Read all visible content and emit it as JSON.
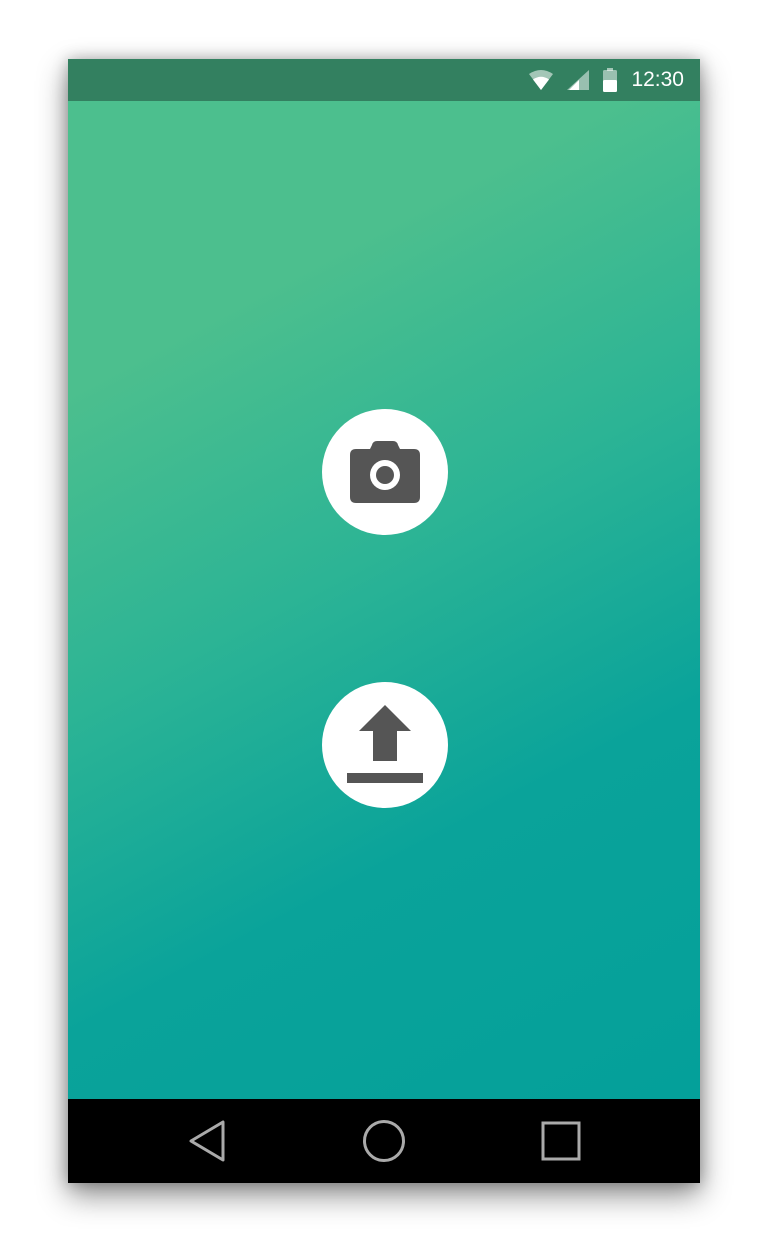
{
  "status_bar": {
    "time": "12:30",
    "icons": [
      "wifi-icon",
      "cell-signal-icon",
      "battery-icon"
    ],
    "background_color": "#338060"
  },
  "main": {
    "background_gradient": [
      "#4cbf8e",
      "#04a09a"
    ],
    "buttons": [
      {
        "name": "camera-button",
        "icon": "camera-icon"
      },
      {
        "name": "upload-button",
        "icon": "upload-icon"
      }
    ],
    "icon_color": "#555555"
  },
  "nav_bar": {
    "buttons": [
      {
        "name": "back-button",
        "icon": "back-triangle-icon"
      },
      {
        "name": "home-button",
        "icon": "home-circle-icon"
      },
      {
        "name": "recents-button",
        "icon": "recents-square-icon"
      }
    ],
    "background_color": "#000000"
  }
}
